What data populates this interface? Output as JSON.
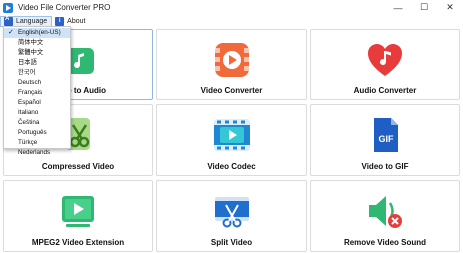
{
  "window": {
    "title": "Video File Converter PRO",
    "controls": {
      "minimize": "—",
      "maximize": "☐",
      "close": "✕"
    }
  },
  "menu": {
    "language": "Language",
    "about": "About",
    "about_icon_text": "i"
  },
  "language_dropdown": {
    "items": [
      "English(en-US)",
      "简体中文",
      "繁體中文",
      "日本語",
      "한국어",
      "Deutsch",
      "Français",
      "Español",
      "Italiano",
      "Čeština",
      "Português",
      "Türkçe",
      "Nederlands"
    ],
    "selected_index": 0
  },
  "tiles": [
    {
      "label": "Video to Audio",
      "icon": "video-to-audio-icon",
      "color": "#2eb872"
    },
    {
      "label": "Video Converter",
      "icon": "play-icon",
      "color": "#f06a3b"
    },
    {
      "label": "Audio Converter",
      "icon": "heart-music-icon",
      "color": "#e83b3b"
    },
    {
      "label": "Compressed Video",
      "icon": "scissors-icon",
      "color": "#7bc247"
    },
    {
      "label": "Video Codec",
      "icon": "film-codec-icon",
      "color": "#1e88d4"
    },
    {
      "label": "Video to GIF",
      "icon": "gif-file-icon",
      "color": "#1f5fc4"
    },
    {
      "label": "MPEG2 Video Extension",
      "icon": "video-play-screen-icon",
      "color": "#2eb872"
    },
    {
      "label": "Split Video",
      "icon": "split-scissors-icon",
      "color": "#1e6fd0"
    },
    {
      "label": "Remove Video Sound",
      "icon": "mute-speaker-icon",
      "color": "#2eb872"
    }
  ]
}
